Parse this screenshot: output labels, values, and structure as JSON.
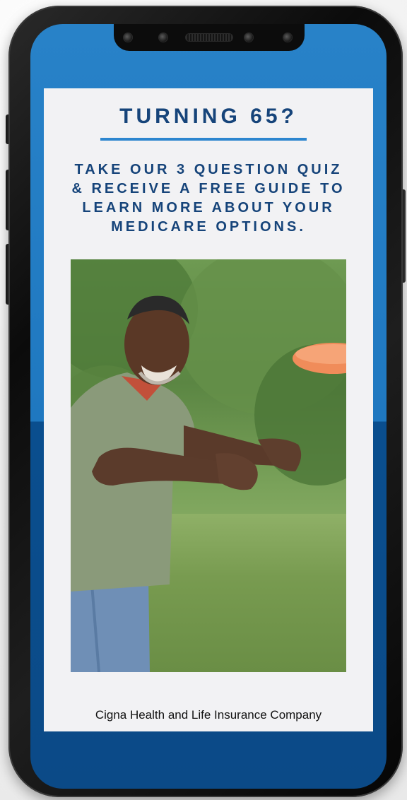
{
  "ad": {
    "headline": "TURNING 65?",
    "subhead_lines": [
      "TAKE OUR 3 QUESTION QUIZ",
      "& RECEIVE A FREE GUIDE TO",
      "LEARN MORE ABOUT YOUR",
      "MEDICARE OPTIONS."
    ],
    "footer": "Cigna Health and Life Insurance Company"
  },
  "colors": {
    "headline_blue": "#16447a",
    "rule_blue": "#2d86cf",
    "screen_blue_top": "#2882c8",
    "screen_blue_bottom": "#0b4a87",
    "card_background": "#f2f2f4"
  },
  "icons": {
    "camera": "camera-icon",
    "sensor": "sensor-icon",
    "speaker": "speaker-grille-icon"
  }
}
